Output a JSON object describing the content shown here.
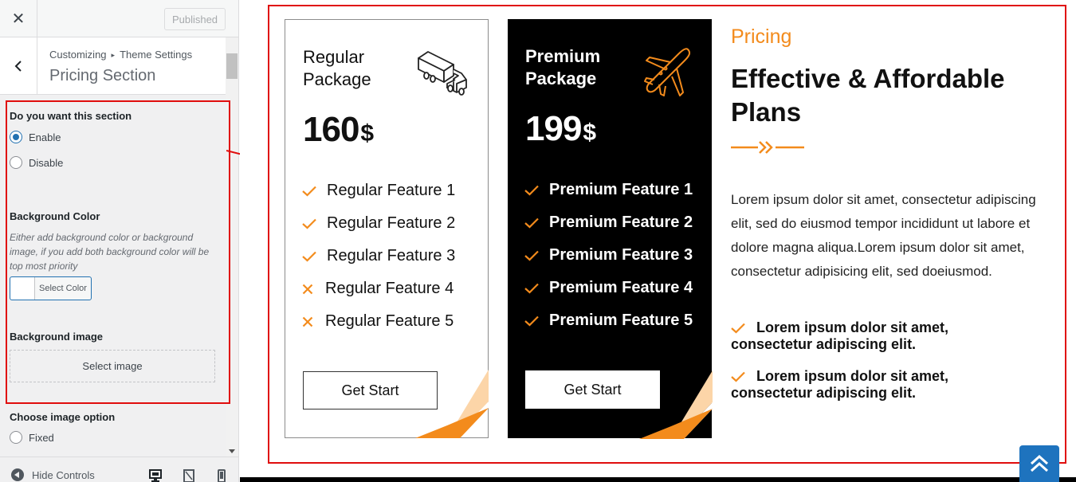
{
  "customizer": {
    "published_label": "Published",
    "breadcrumb": {
      "root": "Customizing",
      "separator": "▸",
      "current": "Theme Settings"
    },
    "section_title": "Pricing Section",
    "enable_section": {
      "label": "Do you want this section",
      "options": [
        "Enable",
        "Disable"
      ],
      "selected": "Enable"
    },
    "background_color": {
      "label": "Background Color",
      "description": "Either add background color or background image, if you add both background color will be top most priority",
      "button_label": "Select Color"
    },
    "background_image": {
      "label": "Background image",
      "button_label": "Select image"
    },
    "image_option": {
      "label": "Choose image option",
      "first_option": "Fixed"
    },
    "footer": {
      "hide_controls_label": "Hide Controls"
    }
  },
  "preview": {
    "accent_color": "#f38b1c",
    "highlight_color": "#e00d0d",
    "regular": {
      "title_line1": "Regular",
      "title_line2": "Package",
      "icon": "truck-icon",
      "price": "160",
      "currency": "$",
      "features": [
        {
          "label": "Regular Feature 1",
          "included": true
        },
        {
          "label": "Regular Feature 2",
          "included": true
        },
        {
          "label": "Regular Feature 3",
          "included": true
        },
        {
          "label": "Regular Feature 4",
          "included": false
        },
        {
          "label": "Regular Feature 5",
          "included": false
        }
      ],
      "button_label": "Get Start"
    },
    "premium": {
      "title_line1": "Premium",
      "title_line2": "Package",
      "icon": "airplane-icon",
      "price": "199",
      "currency": "$",
      "features": [
        {
          "label": "Premium Feature 1",
          "included": true
        },
        {
          "label": "Premium Feature 2",
          "included": true
        },
        {
          "label": "Premium Feature 3",
          "included": true
        },
        {
          "label": "Premium Feature 4",
          "included": true
        },
        {
          "label": "Premium Feature 5",
          "included": true
        }
      ],
      "button_label": "Get Start"
    },
    "eyebrow": "Pricing",
    "heading": "Effective & Affordable Plans",
    "description": "Lorem ipsum dolor sit amet, consectetur adipiscing elit, sed do eiusmod tempor incididunt ut labore et dolore magna aliqua.Lorem ipsum dolor sit amet, consectetur adipisicing elit, sed doeiusmod.",
    "bullets": [
      "Lorem ipsum dolor sit amet, consectetur adipiscing elit.",
      "Lorem ipsum dolor sit amet, consectetur adipiscing elit."
    ]
  }
}
